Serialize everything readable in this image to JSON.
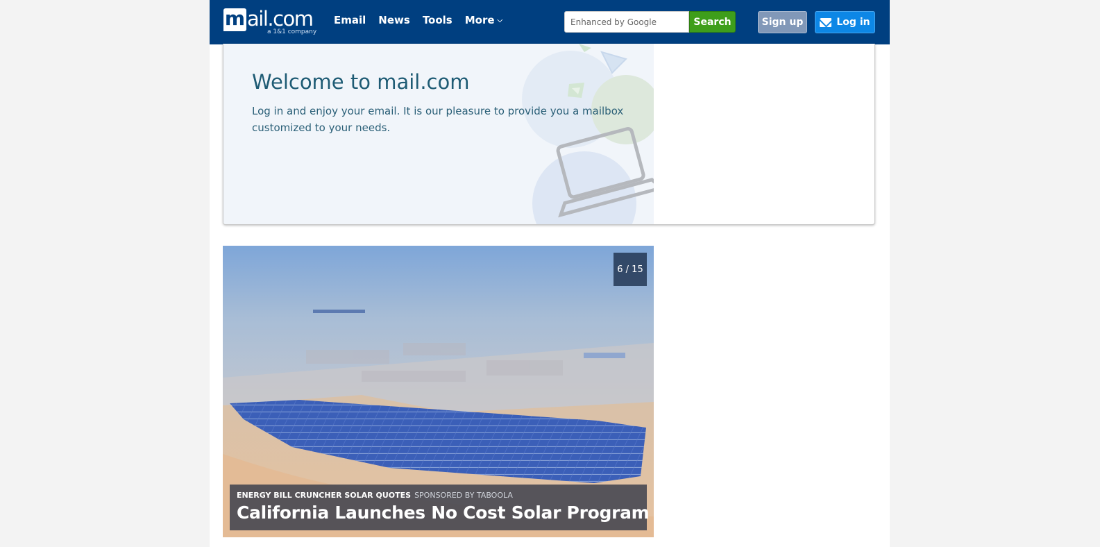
{
  "header": {
    "logo_text": "mail.com",
    "logo_letter": "m",
    "logo_rest": "ail.com",
    "logo_sub": "a 1&1 company",
    "nav": [
      {
        "label": "Email"
      },
      {
        "label": "News"
      },
      {
        "label": "Tools"
      },
      {
        "label": "More"
      }
    ],
    "search": {
      "placeholder": "Enhanced by Google",
      "button_label": "Search"
    },
    "signup_label": "Sign up",
    "login_label": "Log in"
  },
  "welcome": {
    "title": "Welcome to mail.com",
    "text": "Log in and enjoy your email. It is our pleasure to provide you a mailbox customized to your needs."
  },
  "article": {
    "counter": "6 / 15",
    "source": "ENERGY BILL CRUNCHER SOLAR QUOTES",
    "sponsor": "SPONSORED BY TABOOLA",
    "title": "California Launches No Cost Solar Program"
  },
  "colors": {
    "header_bg": "#003f80",
    "search_button": "#3e9e1b",
    "signup_button": "#8198b8",
    "login_button": "#0d87e6",
    "welcome_title": "#1e5b74"
  }
}
